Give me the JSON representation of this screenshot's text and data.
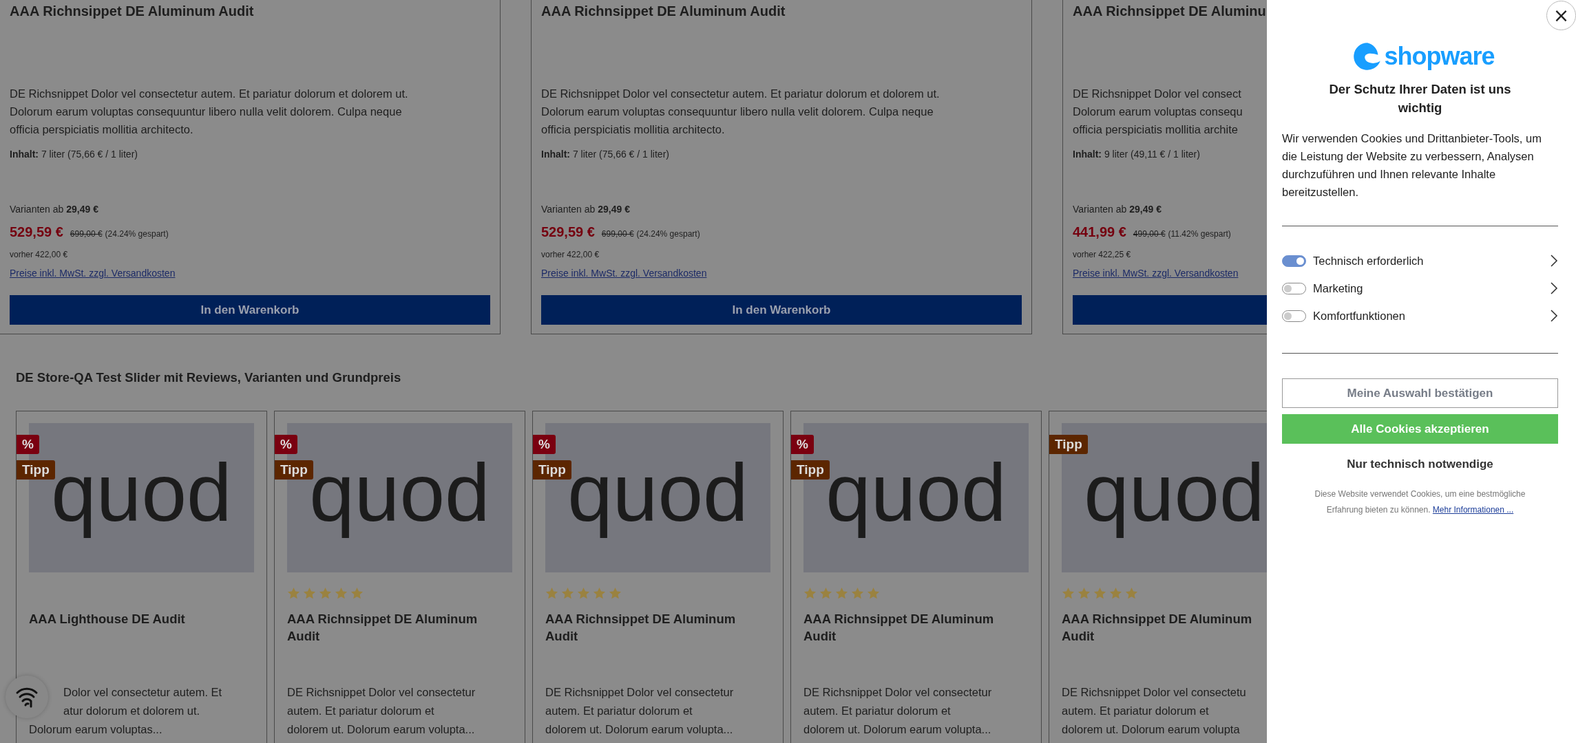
{
  "product_row": [
    {
      "title": "AAA Richnsippet DE Aluminum Audit",
      "description_lines": [
        "DE Richsnippet Dolor vel consectetur autem. Et pariatur dolorum et dolorem ut.",
        "Dolorum earum voluptas consequuntur libero nulla velit dolorem. Culpa neque",
        "officia perspiciatis mollitia architecto."
      ],
      "content_label": "Inhalt:",
      "content_value": "7 liter (75,66 € / 1 liter)",
      "variants_label": "Varianten ab",
      "variants_price": "29,49 €",
      "price": "529,59 €",
      "old_price": "699,00 €",
      "savings": "(24.24% gespart)",
      "before": "vorher 422,00 €",
      "tax_link": "Preise inkl. MwSt. zzgl. Versandkosten",
      "button": "In den Warenkorb"
    },
    {
      "title": "AAA Richnsippet DE Aluminum Audit",
      "description_lines": [
        "DE Richsnippet Dolor vel consectetur autem. Et pariatur dolorum et dolorem ut.",
        "Dolorum earum voluptas consequuntur libero nulla velit dolorem. Culpa neque",
        "officia perspiciatis mollitia architecto."
      ],
      "content_label": "Inhalt:",
      "content_value": "7 liter (75,66 € / 1 liter)",
      "variants_label": "Varianten ab",
      "variants_price": "29,49 €",
      "price": "529,59 €",
      "old_price": "699,00 €",
      "savings": "(24.24% gespart)",
      "before": "vorher 422,00 €",
      "tax_link": "Preise inkl. MwSt. zzgl. Versandkosten",
      "button": "In den Warenkorb"
    },
    {
      "title": "AAA Richnsippet DE Aluminu",
      "description_lines": [
        "DE Richsnippet Dolor vel consect",
        "Dolorum earum voluptas consequ",
        "officia perspiciatis mollitia archite"
      ],
      "content_label": "Inhalt:",
      "content_value": "9 liter (49,11 € / 1 liter)",
      "variants_label": "Varianten ab",
      "variants_price": "29,49 €",
      "price": "441,99 €",
      "old_price": "499,00 €",
      "savings": "(11.42% gespart)",
      "before": "vorher 422,25 €",
      "tax_link": "Preise inkl. MwSt. zzgl. Versandkosten"
    }
  ],
  "slider": {
    "title": "DE Store-QA Test Slider mit Reviews, Varianten und Grundpreis",
    "products": [
      {
        "badges": [
          {
            "kind": "discount",
            "label": "%"
          },
          {
            "kind": "tip",
            "label": "Tipp"
          }
        ],
        "image_text": "quod",
        "title": "AAA Lighthouse DE Audit",
        "description_lines": [
          "Dolor vel consectetur autem. Et",
          "atur dolorum et dolorem ut.",
          "Dolorum earum voluptas..."
        ]
      },
      {
        "badges": [
          {
            "kind": "discount",
            "label": "%"
          },
          {
            "kind": "tip",
            "label": "Tipp"
          }
        ],
        "image_text": "quod",
        "stars": 5,
        "title": "AAA Richnsippet DE Aluminum Audit",
        "description_lines": [
          "DE Richsnippet Dolor vel consectetur",
          "autem. Et pariatur dolorum et",
          "dolorem ut. Dolorum earum volupta..."
        ]
      },
      {
        "badges": [
          {
            "kind": "discount",
            "label": "%"
          },
          {
            "kind": "tip",
            "label": "Tipp"
          }
        ],
        "image_text": "quod",
        "stars": 5,
        "title": "AAA Richnsippet DE Aluminum Audit",
        "description_lines": [
          "DE Richsnippet Dolor vel consectetur",
          "autem. Et pariatur dolorum et",
          "dolorem ut. Dolorum earum volupta..."
        ]
      },
      {
        "badges": [
          {
            "kind": "discount",
            "label": "%"
          },
          {
            "kind": "tip",
            "label": "Tipp"
          }
        ],
        "image_text": "quod",
        "stars": 5,
        "title": "AAA Richnsippet DE Aluminum Audit",
        "description_lines": [
          "DE Richsnippet Dolor vel consectetur",
          "autem. Et pariatur dolorum et",
          "dolorem ut. Dolorum earum volupta..."
        ]
      },
      {
        "badges": [
          {
            "kind": "tip",
            "label": "Tipp"
          }
        ],
        "image_text": "quod",
        "stars": 5,
        "title": "AAA Richnsippet DE Aluminum Audit",
        "description_lines": [
          "DE Richsnippet Dolor vel consectetu",
          "autem. Et pariatur dolorum et",
          "dolorem ut. Dolorum earum volupta"
        ]
      }
    ]
  },
  "cookie_panel": {
    "close": "×",
    "logo_text": "shopware",
    "title": "Der Schutz Ihrer Daten ist uns wichtig",
    "text": "Wir verwenden Cookies und Drittanbieter-Tools, um die Leistung der Website zu verbessern, Analysen durchzuführen und Ihnen relevante Inhalte bereitzustellen.",
    "categories": [
      {
        "label": "Technisch erforderlich",
        "on": true
      },
      {
        "label": "Marketing",
        "on": false
      },
      {
        "label": "Komfortfunktionen",
        "on": false
      }
    ],
    "confirm_button": "Meine Auswahl bestätigen",
    "accept_button": "Alle Cookies akzeptieren",
    "essential_button": "Nur technisch notwendige",
    "footer_text": "Diese Website verwendet Cookies, um eine bestmögliche Erfahrung bieten zu können.",
    "footer_link": "Mehr Informationen ..."
  }
}
